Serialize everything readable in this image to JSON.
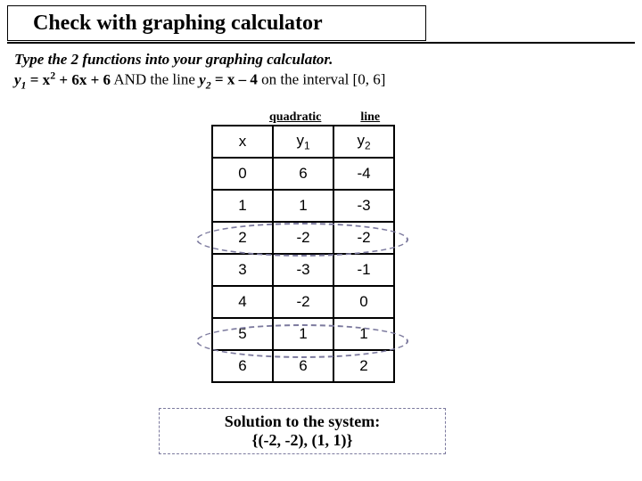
{
  "title": "Check with graphing calculator",
  "instr": {
    "line1_a": "Type the 2 functions into your graphing calculator.",
    "line2_a": "y",
    "line2_b": "1",
    "line2_c": " = x",
    "line2_d": "2",
    "line2_e": " + 6x + 6",
    "line2_f": " AND the line ",
    "line2_g": "y",
    "line2_h": "2",
    "line2_i": " = x – 4",
    "line2_j": "  on the interval [0, 6]"
  },
  "labels": {
    "quadratic": "quadratic",
    "line": "line"
  },
  "chart_data": {
    "type": "table",
    "headers": {
      "x": "x",
      "y1_pre": "y",
      "y1_sub": "1",
      "y2_pre": "y",
      "y2_sub": "2"
    },
    "rows": [
      {
        "x": "0",
        "y1": "6",
        "y2": "-4"
      },
      {
        "x": "1",
        "y1": "1",
        "y2": "-3"
      },
      {
        "x": "2",
        "y1": "-2",
        "y2": "-2"
      },
      {
        "x": "3",
        "y1": "-3",
        "y2": "-1"
      },
      {
        "x": "4",
        "y1": "-2",
        "y2": "0"
      },
      {
        "x": "5",
        "y1": "1",
        "y2": "1"
      },
      {
        "x": "6",
        "y1": "6",
        "y2": "2"
      }
    ]
  },
  "solution": {
    "line1": "Solution to the system:",
    "line2": "{(-2, -2), (1, 1)}"
  }
}
